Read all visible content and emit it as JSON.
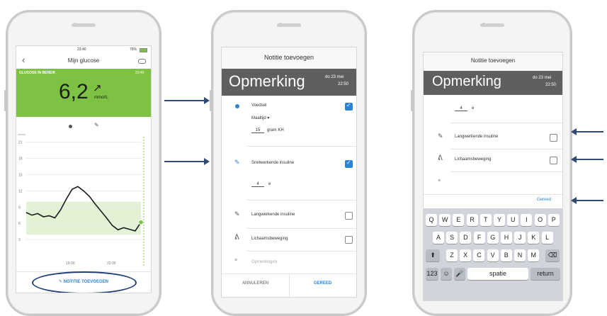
{
  "phone1": {
    "status_time": "23:40",
    "status_battery": "76%",
    "back_icon": "chevron-left-icon",
    "nav_title": "Mijn glucose",
    "settings_icon": "toggle-icon",
    "banner_label": "GLUCOSE IN BEREIK",
    "banner_time": "23:40",
    "glucose_value": "6,2",
    "trend_arrow": "↗",
    "glucose_unit": "mmol/L",
    "banner_color": "#7dc242",
    "y_ticks": [
      "21",
      "18",
      "15",
      "12",
      "9",
      "6",
      "3"
    ],
    "y_unit": "mmol/L",
    "x_ticks": [
      "19:00",
      "22:00"
    ],
    "add_note_button": "NOTITIE TOEVOEGEN",
    "chart_data": {
      "type": "line",
      "ylim": [
        0,
        22
      ],
      "target_range": [
        3.9,
        10
      ],
      "x": [
        0,
        1,
        2,
        3,
        4,
        5,
        6,
        7,
        8,
        9,
        10,
        11,
        12,
        13,
        14,
        15,
        16,
        17,
        18,
        19,
        20
      ],
      "values": [
        8,
        7.5,
        7.8,
        7.2,
        7.4,
        7,
        8.5,
        10.5,
        12.3,
        12.8,
        12,
        11,
        9.6,
        8.3,
        7,
        5.6,
        4.8,
        5.2,
        4.9,
        4.6,
        6.2
      ]
    }
  },
  "phone2": {
    "header_title": "Notitie toevoegen",
    "heading": "Opmerking",
    "date": "do 23 mei",
    "time": "22:50",
    "food_label": "Voedsel",
    "meal_label": "Maaltijd",
    "meal_caret": "▾",
    "carbs_value": "15",
    "carbs_unit": "gram KH",
    "rapid_label": "Snelwerkende insuline",
    "rapid_value": "4",
    "rapid_unit": "e",
    "long_label": "Langwerkende insuline",
    "exercise_label": "Lichaamsbeweging",
    "notes_placeholder": "Opmerkingen",
    "cancel_button": "ANNULEREN",
    "done_button": "GEREED"
  },
  "phone3": {
    "header_title": "Notitie toevoegen",
    "heading": "Opmerking",
    "date": "do 23 mei",
    "time": "22:50",
    "insulin_value": "4",
    "insulin_unit": "e",
    "long_label": "Langwerkende insuline",
    "exercise_label": "Lichaamsbeweging",
    "done_link": "Gereed",
    "keyboard": {
      "row1": [
        "Q",
        "W",
        "E",
        "R",
        "T",
        "Y",
        "U",
        "I",
        "O",
        "P"
      ],
      "row2": [
        "A",
        "S",
        "D",
        "F",
        "G",
        "H",
        "J",
        "K",
        "L"
      ],
      "row3": [
        "Z",
        "X",
        "C",
        "V",
        "B",
        "N",
        "M"
      ],
      "shift": "⬆",
      "backspace": "⌫",
      "numbers": "123",
      "emoji": "☺",
      "mic": "🎤",
      "space": "spatie",
      "return": "return"
    }
  },
  "accent_color": "#2b83d6",
  "heading_bar_color": "#5f5f5f"
}
